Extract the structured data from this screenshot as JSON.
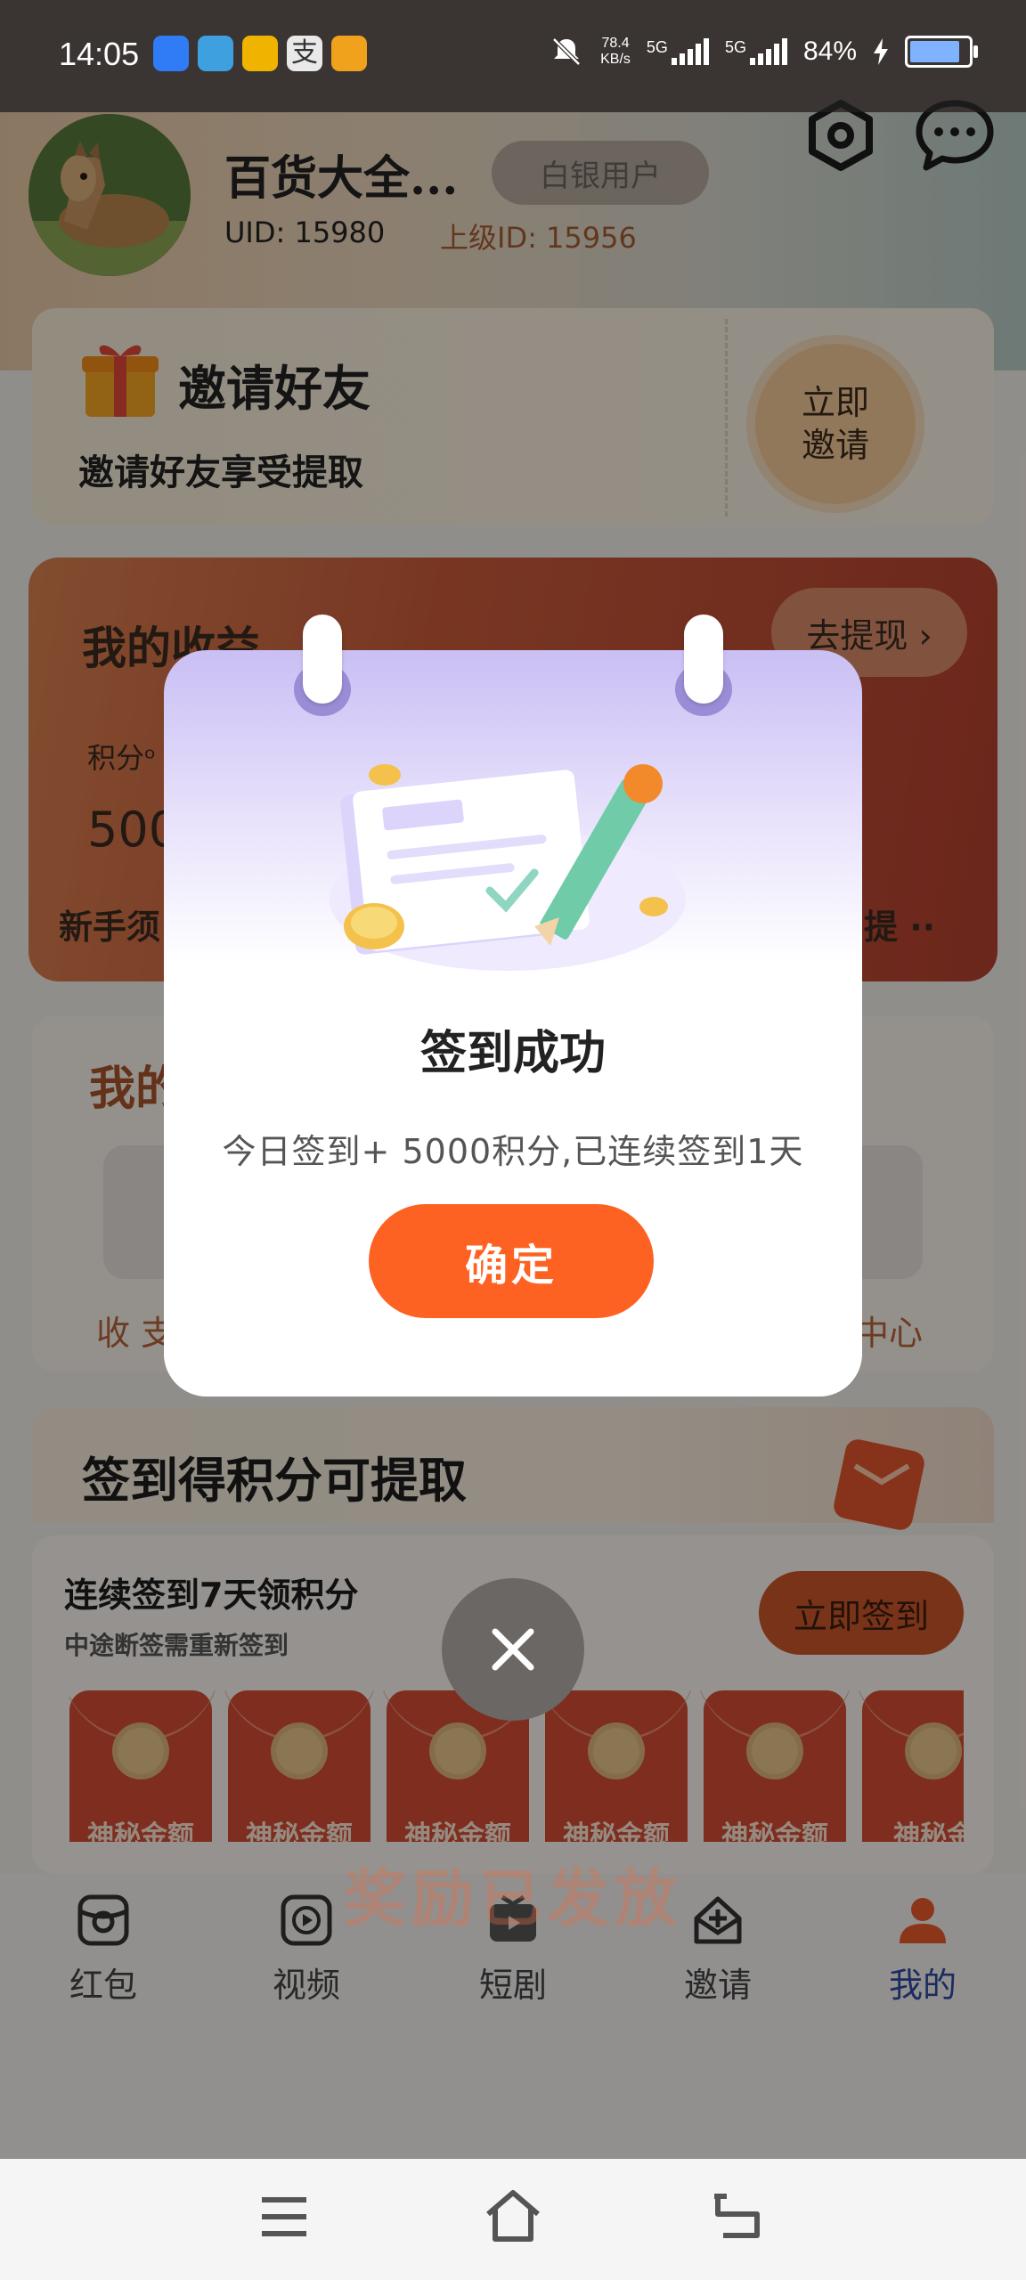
{
  "status_bar": {
    "time": "14:05",
    "net_speed_value": "78.4",
    "net_speed_unit": "KB/s",
    "sim1": "5G",
    "sim2": "5G",
    "battery": "84%"
  },
  "profile": {
    "username": "百货大全...",
    "level": "白银用户",
    "uid": "UID: 15980",
    "parent_id": "上级ID: 15956"
  },
  "invite_card": {
    "title": "邀请好友",
    "subtitle": "邀请好友享受提取",
    "button_line1": "立即",
    "button_line2": "邀请"
  },
  "earnings_card": {
    "title": "我的收益",
    "withdraw_button": "去提现 ›",
    "points_label": "积分ᵒ",
    "points_value": "500",
    "newbie_text": "新手须",
    "right_text": "提 ··"
  },
  "services_card": {
    "title": "我的",
    "left_label": "收 支",
    "right_label": "中心"
  },
  "signin": {
    "title": "签到得积分可提取",
    "continuous_title": "连续签到7天领积分",
    "continuous_sub": "中途断签需重新签到",
    "sign_button": "立即签到",
    "rewards": [
      "神秘金额",
      "神秘金额",
      "神秘金额",
      "神秘金额",
      "神秘金额",
      "神秘金"
    ]
  },
  "reward_released": "奖励已发放",
  "tabs": [
    {
      "label": "红包",
      "icon": "red-packet-icon",
      "active": false
    },
    {
      "label": "视频",
      "icon": "video-icon",
      "active": false
    },
    {
      "label": "短剧",
      "icon": "drama-icon",
      "active": false
    },
    {
      "label": "邀请",
      "icon": "invite-icon",
      "active": false
    },
    {
      "label": "我的",
      "icon": "profile-icon",
      "active": true
    }
  ],
  "dialog": {
    "title": "签到成功",
    "message": "今日签到+ 5000积分,已连续签到1天",
    "confirm_button": "确定"
  },
  "colors": {
    "accent_orange": "#fe6222",
    "active_tab": "#2e4a9e",
    "dialog_gradient_top": "#c9bff4"
  }
}
